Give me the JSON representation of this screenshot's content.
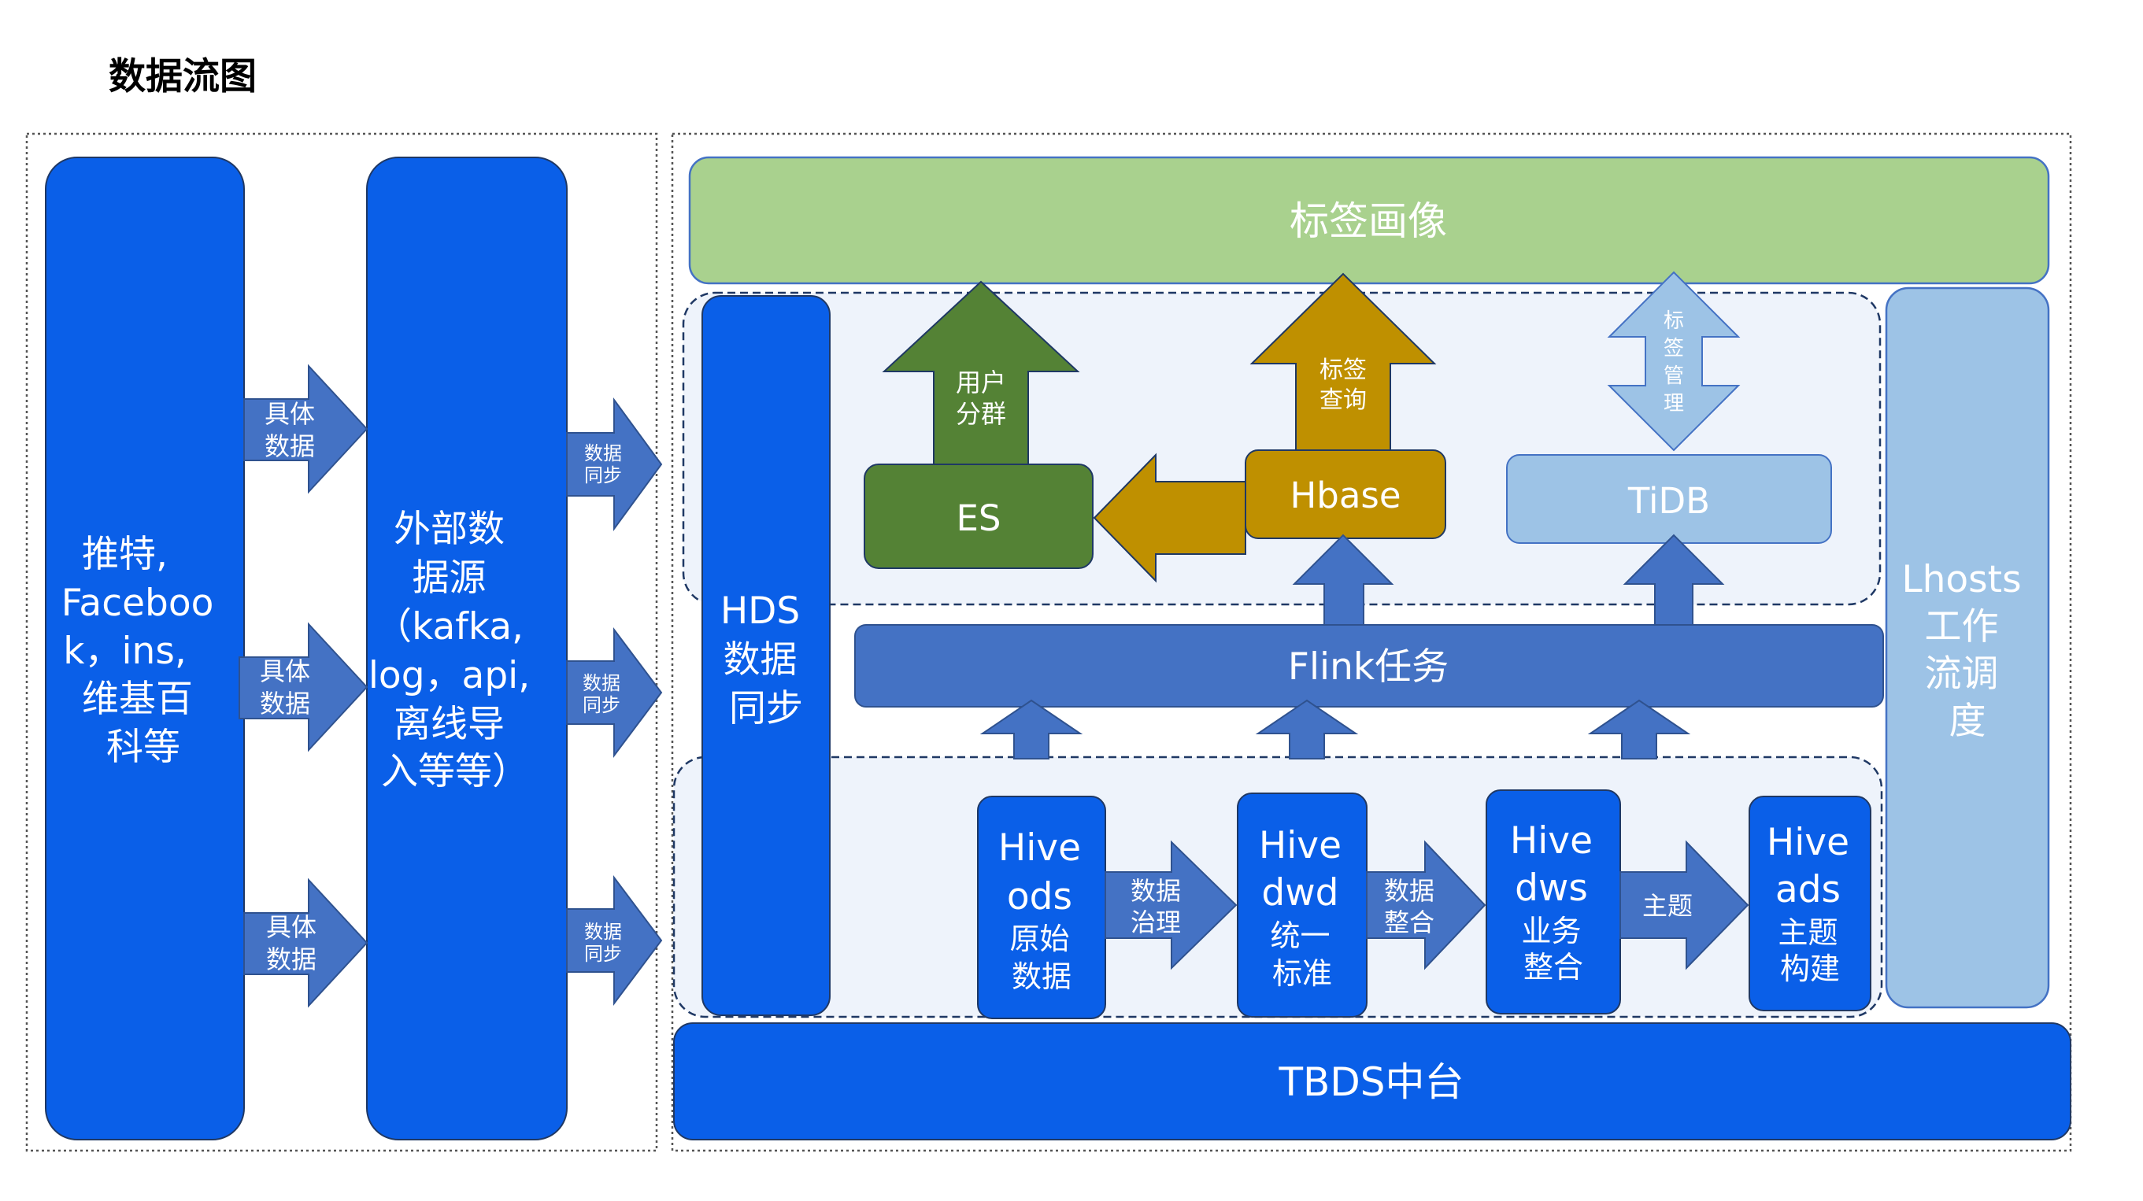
{
  "page": {
    "title": "数据流图"
  },
  "colors": {
    "blue_box": "#0a5fe8",
    "arrow_blue": "#4472c4",
    "green_tag": "#a9d18e",
    "dark_green": "#548235",
    "gold": "#bf9000",
    "light_blue": "#9dc3e6",
    "panel": "#eef3fb",
    "border_dark": "#1f3864"
  },
  "sources": {
    "social": [
      "推特,",
      "Faceboo",
      "k，ins,",
      "维基百",
      "科等"
    ],
    "external": [
      "外部数",
      "据源",
      "（kafka,",
      "log，api,",
      "离线导",
      "入等等）"
    ]
  },
  "left_arrows": {
    "top": [
      "具体",
      "数据"
    ],
    "middle": [
      "具体",
      "数据"
    ],
    "bottom": [
      "具体",
      "数据"
    ]
  },
  "sync_arrows": {
    "top": [
      "数据",
      "同步"
    ],
    "middle": [
      "数据",
      "同步"
    ],
    "bottom": [
      "数据",
      "同步"
    ]
  },
  "right": {
    "tag_portrait": "标签画像",
    "hds": [
      "HDS",
      "数据",
      "同步"
    ],
    "lhosts": [
      "Lhosts",
      "工作",
      "流调",
      "度"
    ],
    "tbds": "TBDS中台",
    "flink": "Flink任务"
  },
  "stores": {
    "es": "ES",
    "hbase": "Hbase",
    "tidb": "TiDB"
  },
  "up_arrows": {
    "user_group": [
      "用户",
      "分群"
    ],
    "tag_query": [
      "标签",
      "查询"
    ],
    "tag_manage": [
      "标",
      "签",
      "管",
      "理"
    ]
  },
  "hive": {
    "ods": [
      "Hive",
      "ods",
      "原始",
      "数据"
    ],
    "dwd": [
      "Hive",
      "dwd",
      "统一",
      "标准"
    ],
    "dws": [
      "Hive",
      "dws",
      "业务",
      "整合"
    ],
    "ads": [
      "Hive",
      "ads",
      "主题",
      "构建"
    ]
  },
  "hive_arrows": {
    "governance": [
      "数据",
      "治理"
    ],
    "integration": [
      "数据",
      "整合"
    ],
    "topic": [
      "主题"
    ]
  }
}
